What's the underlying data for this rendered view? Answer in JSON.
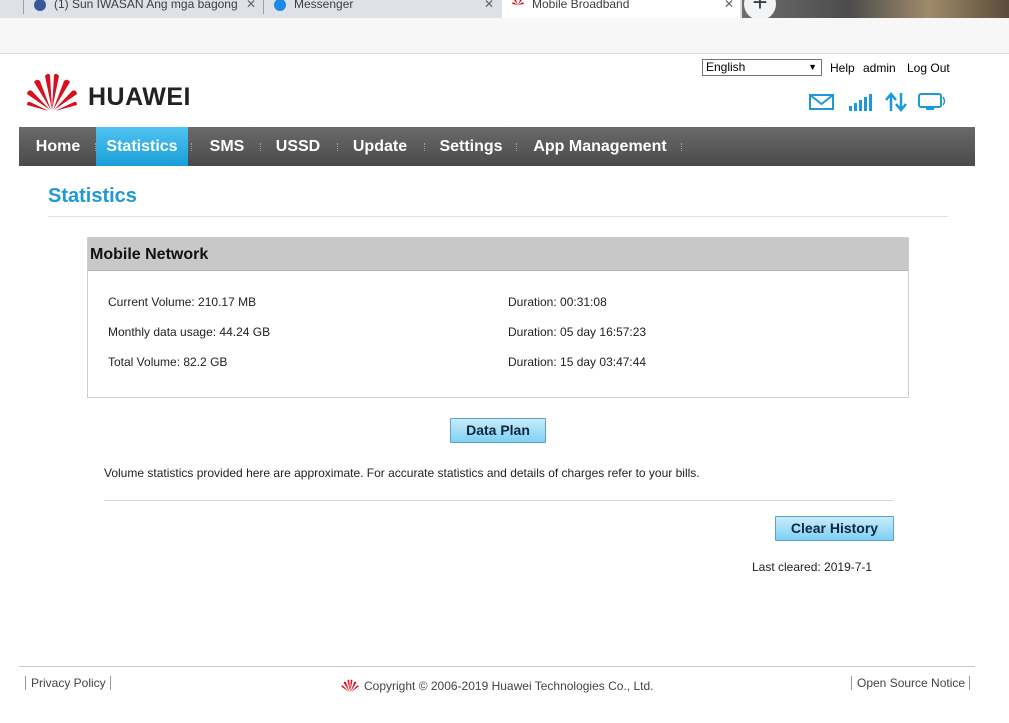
{
  "browser": {
    "tabs": [
      {
        "title": "(1) Sun IWASAN Ang mga bagong",
        "close": "✕"
      },
      {
        "title": "Messenger",
        "close": "✕"
      },
      {
        "title": "Mobile Broadband",
        "close": "✕"
      }
    ],
    "new_tab_symbol": "+"
  },
  "header": {
    "language": "English",
    "links": {
      "help": "Help",
      "user": "admin",
      "logout": "Log Out"
    },
    "brand": "HUAWEI",
    "icons": [
      "envelope-icon",
      "signal-icon",
      "data-transfer-icon",
      "monitor-icon"
    ],
    "accent_color": "#1d9ad6",
    "logo_color": "#d7121e"
  },
  "nav": {
    "items": [
      "Home",
      "Statistics",
      "SMS",
      "USSD",
      "Update",
      "Settings",
      "App Management"
    ],
    "active": "Statistics"
  },
  "main": {
    "title": "Statistics",
    "panel_title": "Mobile Network",
    "stats": [
      {
        "label": "Current Volume: 210.17 MB",
        "duration": "Duration: 00:31:08"
      },
      {
        "label": "Monthly data usage: 44.24 GB",
        "duration": "Duration: 05 day 16:57:23"
      },
      {
        "label": "Total Volume: 82.2 GB",
        "duration": "Duration: 15 day 03:47:44"
      }
    ],
    "data_plan_button": "Data Plan",
    "note": "Volume statistics provided here are approximate. For accurate statistics and details of charges refer to your bills.",
    "clear_history_button": "Clear History",
    "last_cleared": "Last cleared: 2019-7-1"
  },
  "footer": {
    "privacy": "Privacy Policy",
    "copyright": "Copyright © 2006-2019 Huawei Technologies Co., Ltd.",
    "open_source": "Open Source Notice"
  }
}
